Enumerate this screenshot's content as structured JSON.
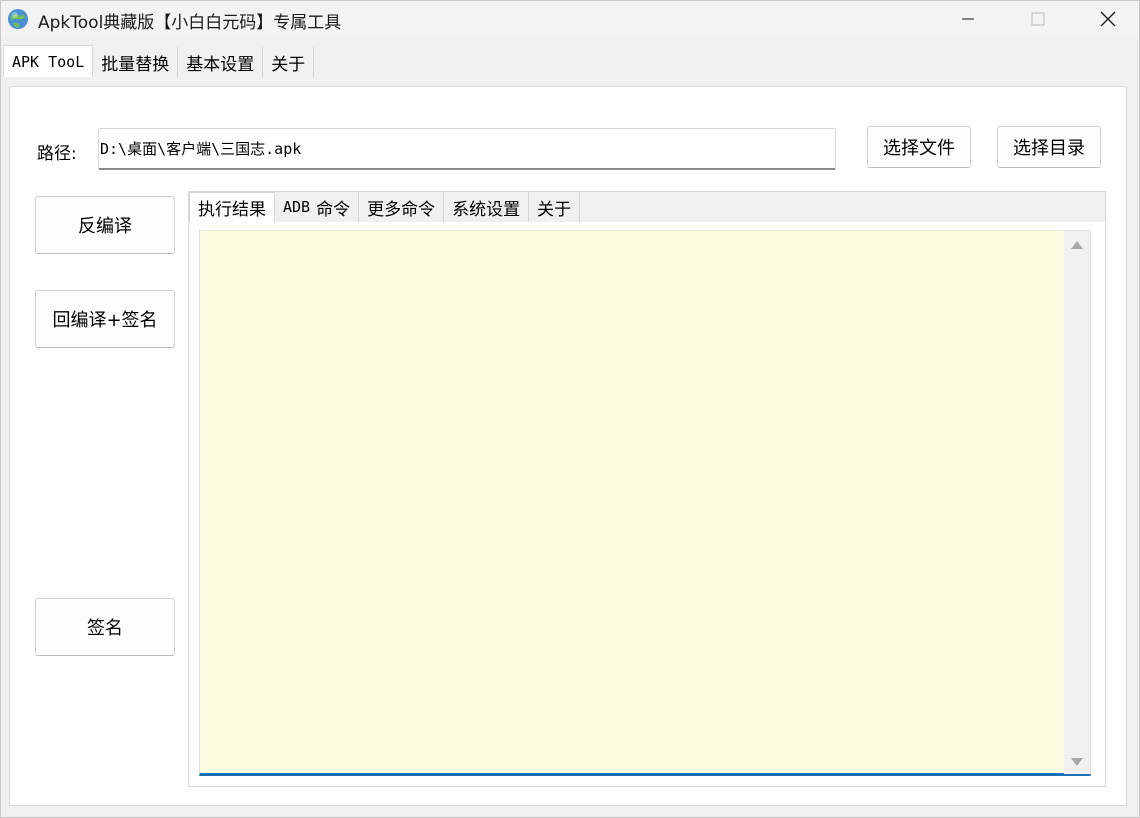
{
  "window": {
    "title": "ApkTool典藏版【小白白元码】专属工具"
  },
  "top_tabs": [
    {
      "label": "APK TooL",
      "active": true
    },
    {
      "label": "批量替换",
      "active": false
    },
    {
      "label": "基本设置",
      "active": false
    },
    {
      "label": "关于",
      "active": false
    }
  ],
  "path": {
    "label": "路径:",
    "value": "D:\\桌面\\客户端\\三国志.apk"
  },
  "buttons": {
    "choose_file": "选择文件",
    "choose_dir": "选择目录",
    "decompile": "反编译",
    "recompile_sign": "回编译+签名",
    "sign": "签名"
  },
  "inner_tabs": [
    {
      "label_mono": "执行结果",
      "active": true
    },
    {
      "label_mono": "ADB",
      "label": "命令",
      "active": false
    },
    {
      "label": "更多命令",
      "active": false
    },
    {
      "label": "系统设置",
      "active": false
    },
    {
      "label": "关于",
      "active": false
    }
  ],
  "output": {
    "text": ""
  },
  "colors": {
    "output_background": "#fffde1",
    "output_focus_line": "#1d6fb8"
  },
  "icons": {
    "app": "globe-icon",
    "minimize": "minimize-icon",
    "maximize": "maximize-icon",
    "close": "close-icon"
  }
}
